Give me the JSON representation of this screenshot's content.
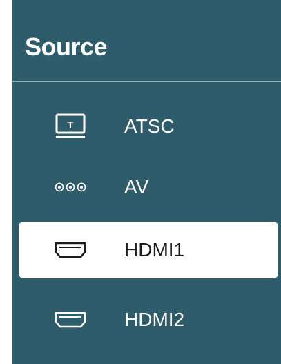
{
  "source_menu": {
    "title": "Source",
    "items": [
      {
        "label": "ATSC",
        "icon": "tv-antenna-icon",
        "selected": false
      },
      {
        "label": "AV",
        "icon": "av-jack-icon",
        "selected": false
      },
      {
        "label": "HDMI1",
        "icon": "hdmi-port-icon",
        "selected": true
      },
      {
        "label": "HDMI2",
        "icon": "hdmi-port-icon",
        "selected": false
      }
    ],
    "colors": {
      "panel_background": "#2f5c6b",
      "divider": "#8fb0bb",
      "text": "#ffffff",
      "selected_background": "#ffffff",
      "selected_text": "#1b1b1b"
    }
  }
}
